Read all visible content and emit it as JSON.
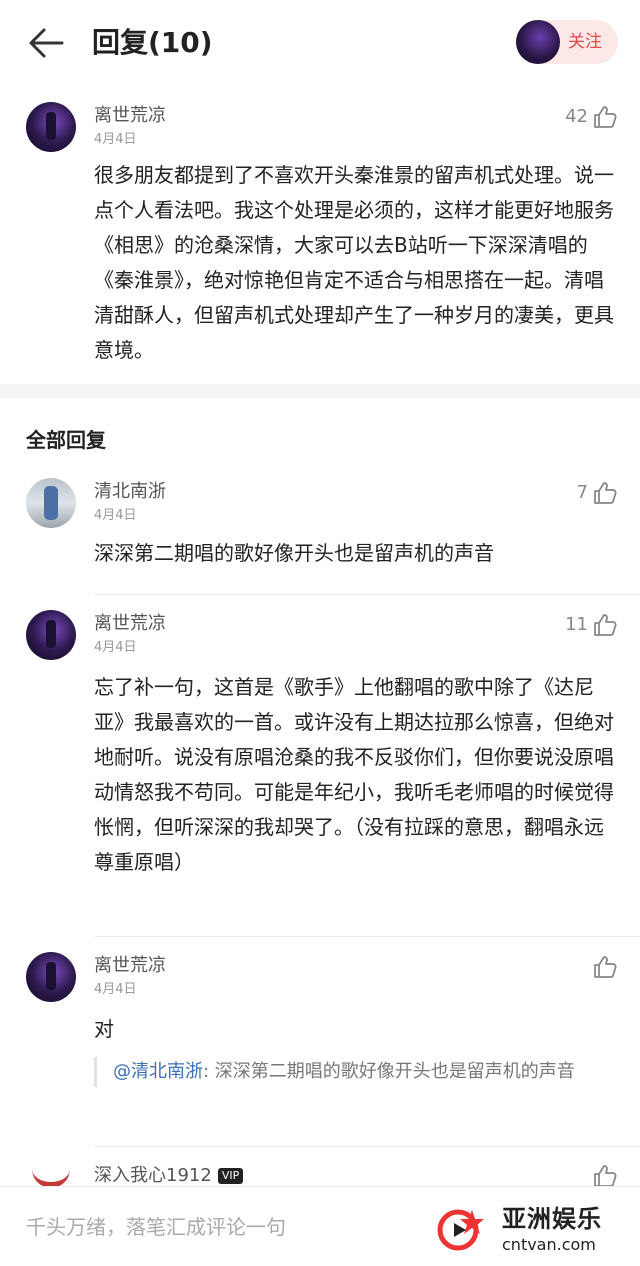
{
  "header": {
    "title": "回复(10)",
    "follow_label": "关注"
  },
  "main_comment": {
    "user": "离世荒凉",
    "date": "4月4日",
    "likes": "42",
    "text": "很多朋友都提到了不喜欢开头秦淮景的留声机式处理。说一点个人看法吧。我这个处理是必须的，这样才能更好地服务《相思》的沧桑深情，大家可以去B站听一下深深清唱的《秦淮景》，绝对惊艳但肯定不适合与相思搭在一起。清唱清甜酥人，但留声机式处理却产生了一种岁月的凄美，更具意境。"
  },
  "section": {
    "title": "全部回复"
  },
  "replies": [
    {
      "user": "清北南浙",
      "date": "4月4日",
      "likes": "7",
      "text": "深深第二期唱的歌好像开头也是留声机的声音"
    },
    {
      "user": "离世荒凉",
      "date": "4月4日",
      "likes": "11",
      "text": "忘了补一句，这首是《歌手》上他翻唱的歌中除了《达尼亚》我最喜欢的一首。或许没有上期达拉那么惊喜，但绝对地耐听。说没有原唱沧桑的我不反驳你们，但你要说没原唱动情怒我不苟同。可能是年纪小，我听毛老师唱的时候觉得怅惘，但听深深的我却哭了。（没有拉踩的意思，翻唱永远尊重原唱）"
    },
    {
      "user": "离世荒凉",
      "date": "4月4日",
      "likes": "",
      "text": "对",
      "quote_mention": "@清北南浙",
      "quote_text": ": 深深第二期唱的歌好像开头也是留声机的声音"
    },
    {
      "user": "深入我心1912",
      "badge": "VIP"
    }
  ],
  "input_bar": {
    "placeholder": "千头万绪，落笔汇成评论一句"
  },
  "watermark": {
    "name": "亚洲娱乐",
    "url": "cntvan.com"
  },
  "colors": {
    "accent": "#e84a4a",
    "mention": "#3b6fb6"
  }
}
